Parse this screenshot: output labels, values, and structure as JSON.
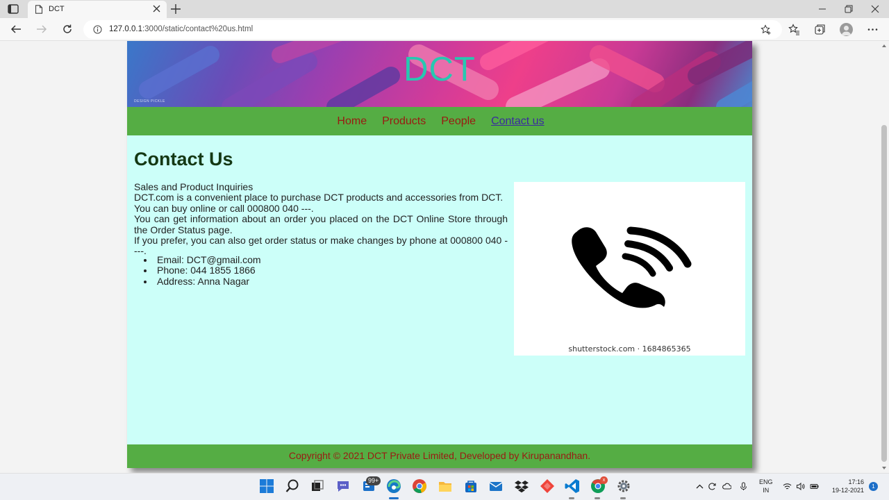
{
  "browser": {
    "tab_title": "DCT",
    "url_host": "127.0.0.1",
    "url_path": ":3000/static/contact%20us.html"
  },
  "site": {
    "banner_title": "DCT",
    "banner_credit": "DESIGN PICKLE",
    "nav": [
      {
        "label": "Home"
      },
      {
        "label": "Products"
      },
      {
        "label": "People"
      },
      {
        "label": "Contact us"
      }
    ],
    "heading": "Contact Us",
    "paragraphs": [
      "Sales and Product Inquiries",
      "DCT.com is a convenient place to purchase DCT products and accessories from DCT.",
      "You can buy online or call 000800 040 ---.",
      "You can get information about an order you placed on the DCT Online Store through the Order Status page.",
      "If you prefer, you can also get order status or make changes by phone at 000800 040 ----."
    ],
    "contacts": [
      "Email: DCT@gmail.com",
      "Phone: 044 1855 1866",
      "Address: Anna Nagar"
    ],
    "image_caption": "shutterstock.com · 1684865365",
    "footer": "Copyright © 2021 DCT Private Limited, Developed by Kirupanandhan."
  },
  "taskbar": {
    "badge_count": "99+",
    "badge_x": "x",
    "lang_top": "ENG",
    "lang_bottom": "IN",
    "time": "17:16",
    "date": "19-12-2021",
    "notifications": "1"
  },
  "colors": {
    "nav_bg": "#55ad44",
    "content_bg": "#ccfff9",
    "banner_text": "#27c8b0",
    "link": "#9a1a12",
    "active_link": "#3a2aa0",
    "heading": "#143814"
  }
}
